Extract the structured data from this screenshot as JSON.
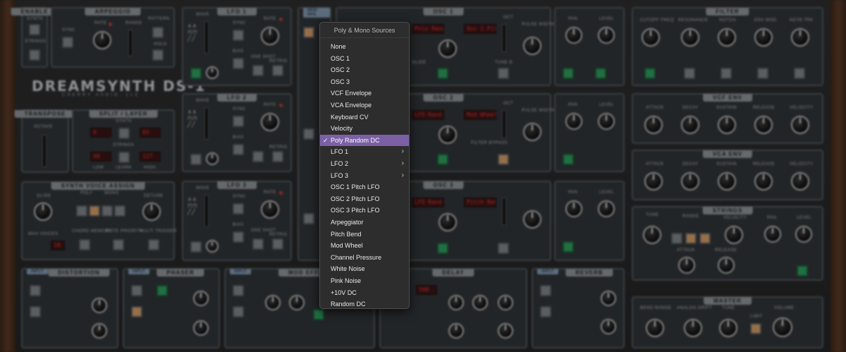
{
  "app": {
    "brand": "DREAMSYNTH DS-1",
    "brand_sub": "CHERRY AUDIO, LLC"
  },
  "panels": {
    "enable": "ENABLE",
    "enable_synth": "SYNTH",
    "enable_strings": "STRINGS",
    "arpeggio": "ARPEGGIO",
    "arp_sync": "SYNC",
    "arp_rate": "RATE",
    "arp_range": "RANGE",
    "arp_pattern": "PATTERN",
    "arp_hold": "HOLD",
    "lfo1": "LFO 1",
    "lfo2": "LFO 2",
    "lfo3": "LFO 3",
    "lfo_wave": "WAVE",
    "lfo_sync": "SYNC",
    "lfo_rate": "RATE",
    "lfo_one_shot": "ONE SHOT",
    "lfo_retrig": "RETRIG",
    "lfo_bias": "BIAS",
    "osc1": "OSC 1",
    "osc2": "OSC 2",
    "osc3": "OSC 3",
    "osc_tune": "TUNE",
    "osc_oct": "OCT",
    "osc_pulse_width": "PULSE WIDTH",
    "osc_glide": "GLIDE",
    "osc_filter_bypass": "FILTER BYPASS",
    "osc_tune_b": "TUNE B",
    "osc1_display_a": "Poly Rand D",
    "osc1_display_b": "Osc 1 Pitch",
    "osc2_display_a": "LFO Rand D",
    "osc2_display_b": "Mod Wheel",
    "osc3_display_a": "LFO Rand D",
    "osc3_display_b": "Pitch Bend",
    "pan": "PAN",
    "level": "LEVEL",
    "filter": "FILTER",
    "filter_cutoff": "CUTOFF FREQ",
    "filter_resonance": "RESONANCE",
    "filter_notch": "NOTCH",
    "filter_env_mod": "ENV MOD",
    "filter_keybd_trk": "KEYB TRK",
    "vcf_env": "VCF ENV",
    "vca_env": "VCA ENV",
    "env_attack": "ATTACK",
    "env_decay": "DECAY",
    "env_sustain": "SUSTAIN",
    "env_release": "RELEASE",
    "env_velocity": "VELOCITY",
    "transpose": "TRANSPOSE",
    "octave": "OCTAVE",
    "split_layer": "SPLIT / LAYER",
    "split_synth": "SYNTH",
    "split_strings": "STRINGS",
    "split_low": "LOW",
    "split_learn": "LEARN",
    "split_high": "HIGH",
    "split_synth_low": "0",
    "split_synth_high": "65",
    "split_strings_low": "48",
    "split_strings_high": "127",
    "voice_assign": "SYNTH VOICE ASSIGN",
    "va_glide": "GLIDE",
    "va_poly": "POLY",
    "va_mono": "MONO",
    "va_detune": "DETUNE",
    "va_max_voices": "MAX VOICES",
    "va_max_voices_value": "10",
    "va_chord_memory": "CHORD MEMORY",
    "va_note_priority": "NOTE PRIORITY",
    "va_multi_trigger": "MULTI TRIGGER",
    "strings": "STRINGS",
    "strings_tune": "TUNE",
    "strings_range": "RANGE",
    "strings_attack": "ATTACK",
    "strings_release": "RELEASE",
    "distortion": "DISTORTION",
    "phaser": "PHASER",
    "mod_effect": "MOD EFFECT",
    "delay": "DELAY",
    "reverb": "REVERB",
    "master": "MASTER",
    "master_bend_range": "BEND RANGE",
    "master_analog_drift": "ANALOG DRIFT",
    "master_tune": "TUNE",
    "master_limit": "LIMIT",
    "master_volume": "VOLUME",
    "input": "INPUT",
    "delay_display": "500",
    "mod_wheel_label": "MOD WHL"
  },
  "menu": {
    "header": "Poly & Mono Sources",
    "items": [
      {
        "label": "None",
        "selected": false,
        "submenu": false
      },
      {
        "label": "OSC 1",
        "selected": false,
        "submenu": false
      },
      {
        "label": "OSC 2",
        "selected": false,
        "submenu": false
      },
      {
        "label": "OSC 3",
        "selected": false,
        "submenu": false
      },
      {
        "label": "VCF Envelope",
        "selected": false,
        "submenu": false
      },
      {
        "label": "VCA Envelope",
        "selected": false,
        "submenu": false
      },
      {
        "label": "Keyboard CV",
        "selected": false,
        "submenu": false
      },
      {
        "label": "Velocity",
        "selected": false,
        "submenu": false
      },
      {
        "label": "Poly Random DC",
        "selected": true,
        "submenu": false
      },
      {
        "label": "LFO 1",
        "selected": false,
        "submenu": true
      },
      {
        "label": "LFO 2",
        "selected": false,
        "submenu": true
      },
      {
        "label": "LFO 3",
        "selected": false,
        "submenu": true
      },
      {
        "label": "OSC 1 Pitch LFO",
        "selected": false,
        "submenu": false
      },
      {
        "label": "OSC 2 Pitch LFO",
        "selected": false,
        "submenu": false
      },
      {
        "label": "OSC 3 Pitch LFO",
        "selected": false,
        "submenu": false
      },
      {
        "label": "Arpeggiator",
        "selected": false,
        "submenu": false
      },
      {
        "label": "Pitch Bend",
        "selected": false,
        "submenu": false
      },
      {
        "label": "Mod Wheel",
        "selected": false,
        "submenu": false
      },
      {
        "label": "Channel Pressure",
        "selected": false,
        "submenu": false
      },
      {
        "label": "White Noise",
        "selected": false,
        "submenu": false
      },
      {
        "label": "Pink Noise",
        "selected": false,
        "submenu": false
      },
      {
        "label": "+10V DC",
        "selected": false,
        "submenu": false
      },
      {
        "label": "Random DC",
        "selected": false,
        "submenu": false
      }
    ],
    "check_glyph": "✓",
    "arrow_glyph": "›"
  },
  "colors": {
    "menu_highlight": "#7b60a6",
    "led_red": "#c03a2e",
    "button_orange": "#d19a66",
    "button_green": "#2e9a5c"
  }
}
